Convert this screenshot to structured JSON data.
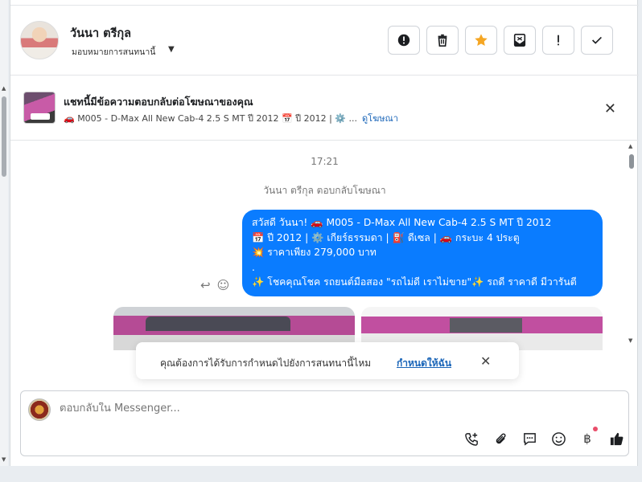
{
  "header": {
    "name": "วันนา ตรีกุล",
    "assign_label": "มอบหมายการสนทนานี้",
    "actions": [
      {
        "name": "report-spam",
        "icon": "exclamation-circle-icon"
      },
      {
        "name": "delete",
        "icon": "trash-icon"
      },
      {
        "name": "star",
        "icon": "star-icon",
        "color": "#f5a623"
      },
      {
        "name": "mark-unread",
        "icon": "envelope-icon"
      },
      {
        "name": "follow-up",
        "icon": "exclamation-icon"
      },
      {
        "name": "done",
        "icon": "check-icon"
      }
    ]
  },
  "ad": {
    "title": "แชทนี้มีข้อความตอบกลับต่อโฆษณาของคุณ",
    "subtitle": "🚗 M005 - D-Max All New Cab-4 2.5 S MT ปี 2012 📅 ปี 2012 | ⚙️ ...",
    "link": "ดูโฆษณา"
  },
  "chat": {
    "time": "17:21",
    "reply_note": "วันนา ตรีกุล ตอบกลับโฆษณา",
    "message_lines": [
      "สวัสดี วันนา! 🚗 M005 - D-Max All New Cab-4 2.5 S MT ปี 2012",
      "📅 ปี 2012 | ⚙️ เกียร์ธรรมดา | ⛽ ดีเซล | 🚗 กระบะ 4 ประตู",
      "💥 ราคาเพียง 279,000 บาท",
      ".",
      "✨ โชคคุณโชค รถยนต์มือสอง \"รถไม่ดี เราไม่ขาย\"✨ รถดี ราคาดี มีวารันตี"
    ]
  },
  "toast": {
    "text": "คุณต้องการได้รับการกำหนดไปยังการสนทนานี้ไหม",
    "link": "กำหนดให้ฉัน"
  },
  "composer": {
    "placeholder": "ตอบกลับใน Messenger..."
  },
  "colors": {
    "bubble": "#0a7cff",
    "link": "#1a65b8",
    "star": "#f5a623",
    "notification_dot": "#e94e6a"
  }
}
